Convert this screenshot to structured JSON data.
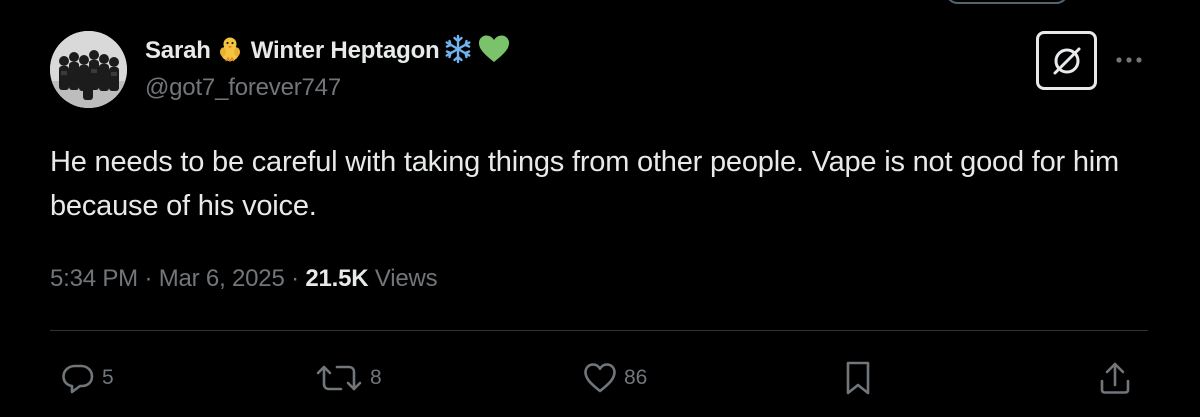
{
  "tweet": {
    "display_name_part1": "Sarah",
    "display_name_part2": "Winter Heptagon",
    "name_emojis": [
      "baby-chick-icon",
      "snowflake-icon",
      "green-heart-icon"
    ],
    "handle": "@got7_forever747",
    "text": "He needs to be careful with taking things from other people. Vape is not good for him because of his voice.",
    "time": "5:34 PM",
    "date": "Mar 6, 2025",
    "separator": "·",
    "views_count": "21.5K",
    "views_label": "Views"
  },
  "actions": {
    "reply_count": "5",
    "retweet_count": "8",
    "like_count": "86"
  },
  "colors": {
    "background": "#000000",
    "text_primary": "#e7e9ea",
    "text_secondary": "#71767b",
    "divider": "#2f3336",
    "green_heart": "#7ac36a",
    "snowflake": "#6fb3f0",
    "chick": "#f5c542"
  }
}
